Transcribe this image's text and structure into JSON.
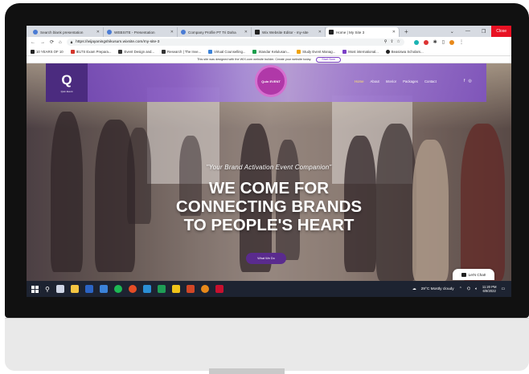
{
  "browser": {
    "tabs": [
      {
        "label": "Search blank presentation",
        "color": "#4a7bd4"
      },
      {
        "label": "WEBSITE - Presentation",
        "color": "#4a7bd4"
      },
      {
        "label": "Company Profile PT Tri Daha",
        "color": "#4a7bd4"
      },
      {
        "label": "Wix Website Editor - my-site",
        "color": "#222222"
      },
      {
        "label": "Home | My Site 3",
        "color": "#222222",
        "active": true
      }
    ],
    "new_tab": "+",
    "close_tooltip": "Close",
    "url": "https://wijayaningshikusum.wixsite.com/my-site-3",
    "bookmarks": [
      "10 YEARS OF 10",
      "IELTS Exam Prepara...",
      "Event Design and...",
      "Research | The Inve...",
      "Virtual Counselling...",
      "Standar Kelulusan...",
      "Study Event Manag...",
      "Most international...",
      "Beasiswa Scholars..."
    ]
  },
  "wix_banner": {
    "text": "This site was designed with the WIX.com website builder. Create your website today.",
    "button": "Start Now"
  },
  "site": {
    "logo_letter": "Q",
    "logo_sub": "Quin Event",
    "center_logo": "Quin EVENT",
    "nav": [
      "Home",
      "About",
      "Interior",
      "Packages",
      "Contact"
    ],
    "social": [
      "f",
      "◎"
    ],
    "tagline": "\"Your Brand Activation Event Companion\"",
    "headline_1": "WE COME FOR",
    "headline_2": "CONNECTING BRANDS",
    "headline_3": "TO PEOPLE'S HEART",
    "cta": "What We Do",
    "chat": "Let's Chat!"
  },
  "taskbar": {
    "weather": "29°C  Mostly cloudy",
    "time": "11:20 PM",
    "date": "6/9/2022"
  }
}
